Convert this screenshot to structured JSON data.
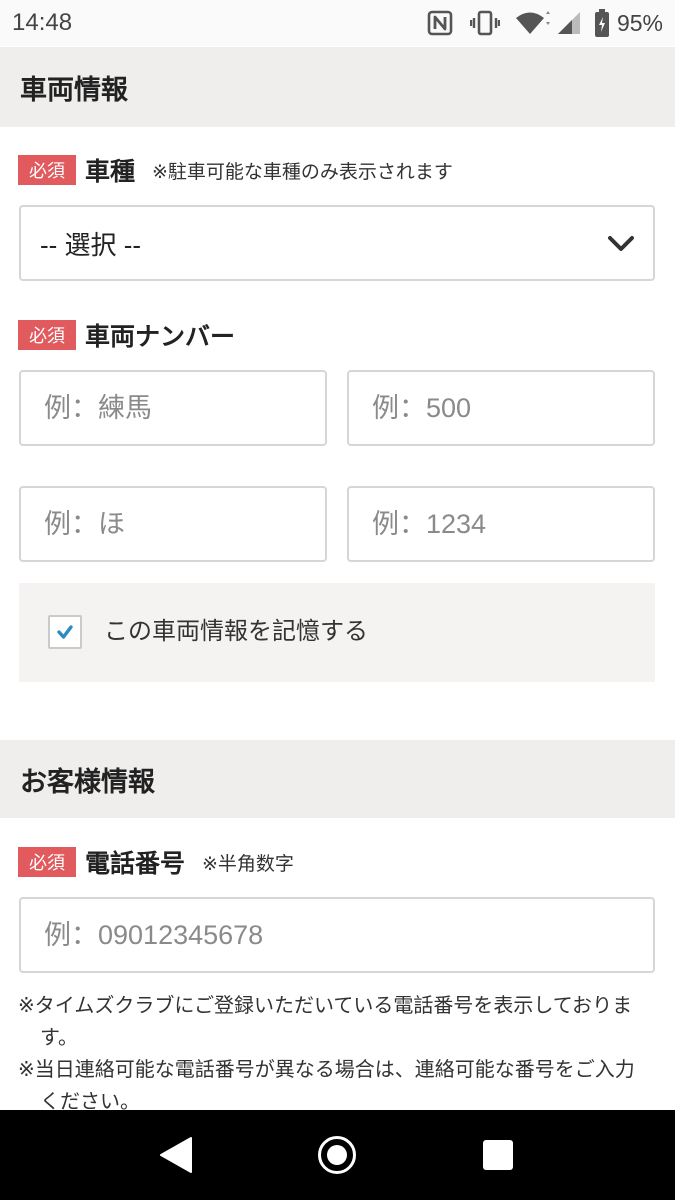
{
  "status_bar": {
    "time": "14:48",
    "battery": "95%",
    "icons": [
      "nfc-icon",
      "vibrate-icon",
      "wifi-icon",
      "signal-icon",
      "battery-icon"
    ]
  },
  "vehicle_section": {
    "title": "車両情報",
    "car_type": {
      "required": "必須",
      "label": "車種",
      "note": "※駐車可能な車種のみ表示されます",
      "selected": "-- 選択 --"
    },
    "plate": {
      "required": "必須",
      "label": "車両ナンバー",
      "placeholders": [
        "例：練馬",
        "例：500",
        "例：ほ",
        "例：1234"
      ]
    },
    "remember": {
      "label": "この車両情報を記憶する",
      "checked": true
    }
  },
  "customer_section": {
    "title": "お客様情報",
    "phone": {
      "required": "必須",
      "label": "電話番号",
      "note": "※半角数字",
      "placeholder": "例：09012345678"
    },
    "notes": [
      "※タイムズクラブにご登録いただいている電話番号を表示しております。",
      "※当日連絡可能な電話番号が異なる場合は、連絡可能な番号をご入力ください。"
    ]
  },
  "nav_bar": {
    "icons": [
      "back-icon",
      "home-icon",
      "recents-icon"
    ]
  },
  "colors": {
    "required_badge": "#e05a5e",
    "checkbox_check": "#2e8bc0",
    "section_background": "#efeeec",
    "panel_background": "#f4f3f1"
  }
}
